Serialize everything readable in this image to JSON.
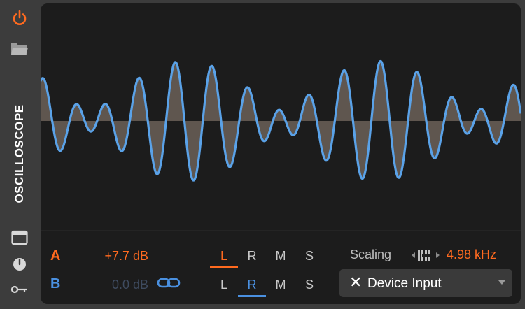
{
  "device": {
    "title": "OSCILLOSCOPE"
  },
  "colors": {
    "accent_orange": "#ff6a1f",
    "accent_blue": "#4a90e0",
    "wave": "#5aa2e8",
    "fill": "#6b6058",
    "panel": "#1c1c1c"
  },
  "sidebar_icons": [
    "power-icon",
    "folder-icon",
    "window-icon",
    "clock-icon",
    "key-icon"
  ],
  "channels": [
    {
      "label": "A",
      "gain": "+7.7 dB",
      "color": "#ff6a1f",
      "gain_color": "#ff6a1f",
      "selected": "L"
    },
    {
      "label": "B",
      "gain": "0.0 dB",
      "color": "#4a90e0",
      "gain_color": "#3e4b5f",
      "selected": "R"
    }
  ],
  "modes": [
    "L",
    "R",
    "M",
    "S"
  ],
  "scaling": {
    "label": "Scaling",
    "value": "4.98 kHz"
  },
  "input": {
    "label": "Device Input"
  }
}
